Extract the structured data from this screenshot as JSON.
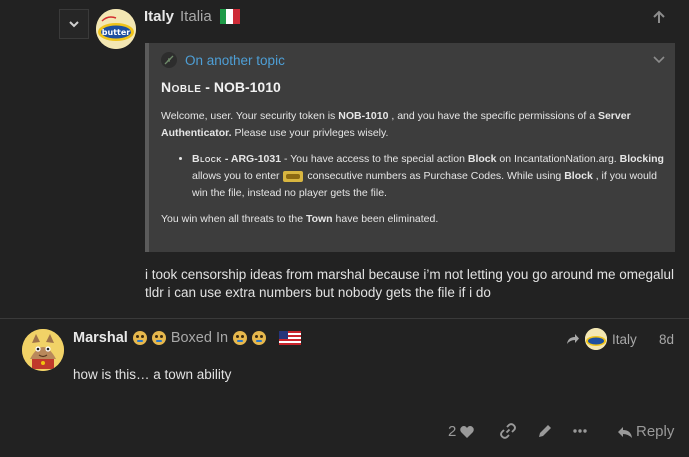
{
  "reply": {
    "username": "Italy",
    "fullname": "Italia",
    "quote": {
      "title": "On another topic",
      "role_small": "Noble",
      "role_code": "NOB-1010",
      "welcome_1": "Welcome, user. Your security token is ",
      "token": "NOB-1010",
      "welcome_2": " , and you have the specific permissions of a ",
      "perm": "Server Authenticator.",
      "welcome_3": " Please use your privleges wisely.",
      "bullet_small": "Block",
      "bullet_code": " - ARG-1031",
      "bullet_1": " - You have access to the special action ",
      "bullet_block": "Block",
      "bullet_2": " on IncantationNation.arg. ",
      "bullet_blocking": "Blocking",
      "bullet_3": " allows you to enter ",
      "bullet_4": " consecutive numbers as Purchase Codes. While using ",
      "bullet_block2": "Block",
      "bullet_5": " , if you would win the file, instead no player gets the file.",
      "win_1": "You win when all threats to the ",
      "win_town": "Town",
      "win_2": " have been eliminated."
    },
    "text_line1": "i took censorship ideas from marshal because i’m not letting you go around me omegalul",
    "text_line2": "tldr i can use extra numbers but nobody gets the file if i do"
  },
  "post": {
    "username": "Marshal",
    "title": "Boxed In",
    "reply_to": "Italy",
    "date": "8d",
    "body": "how is this… a town ability",
    "likes": "2",
    "reply_label": "Reply"
  },
  "colors": {
    "background": "#222222",
    "quote_bg": "#3d3d3d",
    "link": "#4e9fd6",
    "muted": "#a8a8a8"
  },
  "icons": [
    "chevron-down-icon",
    "arrow-up-icon",
    "heart-icon",
    "link-icon",
    "pencil-icon",
    "ellipsis-icon",
    "reply-icon",
    "share-arrow-icon"
  ]
}
